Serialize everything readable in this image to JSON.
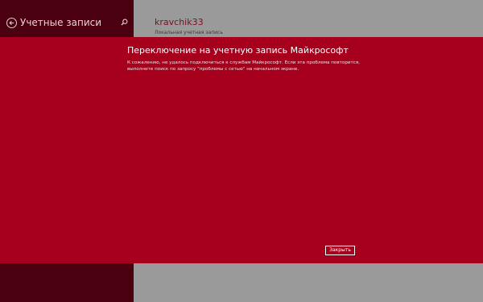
{
  "left_pane": {
    "title": "Учетные записи",
    "back_icon": "back-arrow-icon",
    "search_icon": "search-icon"
  },
  "account": {
    "name": "kravchik33",
    "type": "Локальная учетная запись"
  },
  "dialog": {
    "title": "Переключение на учетную запись Майкрософт",
    "message": "К сожалению, не удалось подключиться к службам Майкрософт. Если эта проблема повторится, выполните поиск по запросу \"проблемы с сетью\" на начальном экране.",
    "close_label": "Закрыть"
  },
  "colors": {
    "dialog_background": "#a6001c",
    "left_pane_background": "#4a000e",
    "right_background": "#9a9a9a"
  }
}
